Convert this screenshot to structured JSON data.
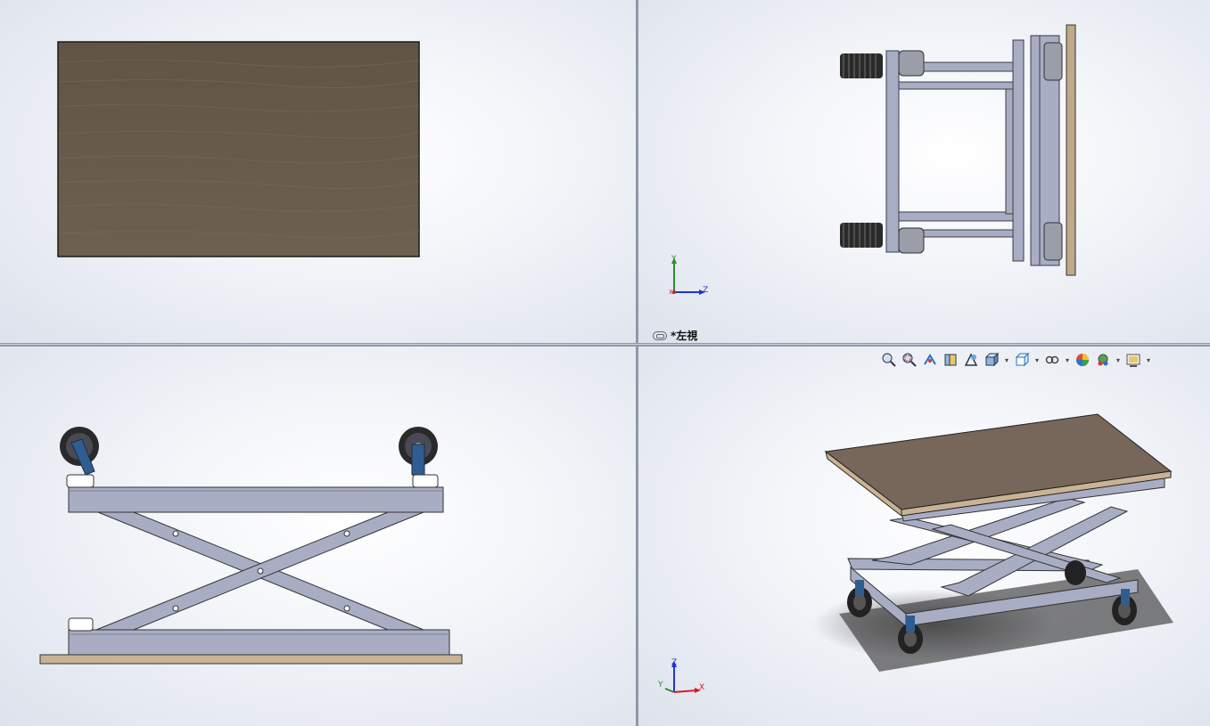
{
  "viewports": {
    "front": {
      "name": "front-view"
    },
    "left": {
      "name": "left-view",
      "label": "*左視"
    },
    "top": {
      "name": "top-view"
    },
    "iso": {
      "name": "isometric-view"
    }
  },
  "triad_left": {
    "up": "Y",
    "right": "Z",
    "origin": "X"
  },
  "triad_iso": {
    "up": "Z",
    "right": "X",
    "left": "Y"
  },
  "toolbar": {
    "items": [
      {
        "name": "zoom-to-fit-icon"
      },
      {
        "name": "zoom-to-area-icon"
      },
      {
        "name": "previous-view-icon"
      },
      {
        "name": "section-view-icon"
      },
      {
        "name": "dynamic-annotation-icon"
      },
      {
        "name": "view-orientation-icon",
        "dropdown": true
      },
      {
        "name": "display-style-icon",
        "dropdown": true
      },
      {
        "name": "hide-show-items-icon",
        "dropdown": true
      },
      {
        "name": "edit-appearance-icon"
      },
      {
        "name": "apply-scene-icon",
        "dropdown": true
      },
      {
        "name": "view-settings-icon",
        "dropdown": true
      }
    ]
  },
  "colors": {
    "wood": "#6b5d4c",
    "steel": "#a9adc4",
    "steel_dark": "#5c6070",
    "caster_blue": "#2f5d8f",
    "background": "#eef1f6"
  }
}
